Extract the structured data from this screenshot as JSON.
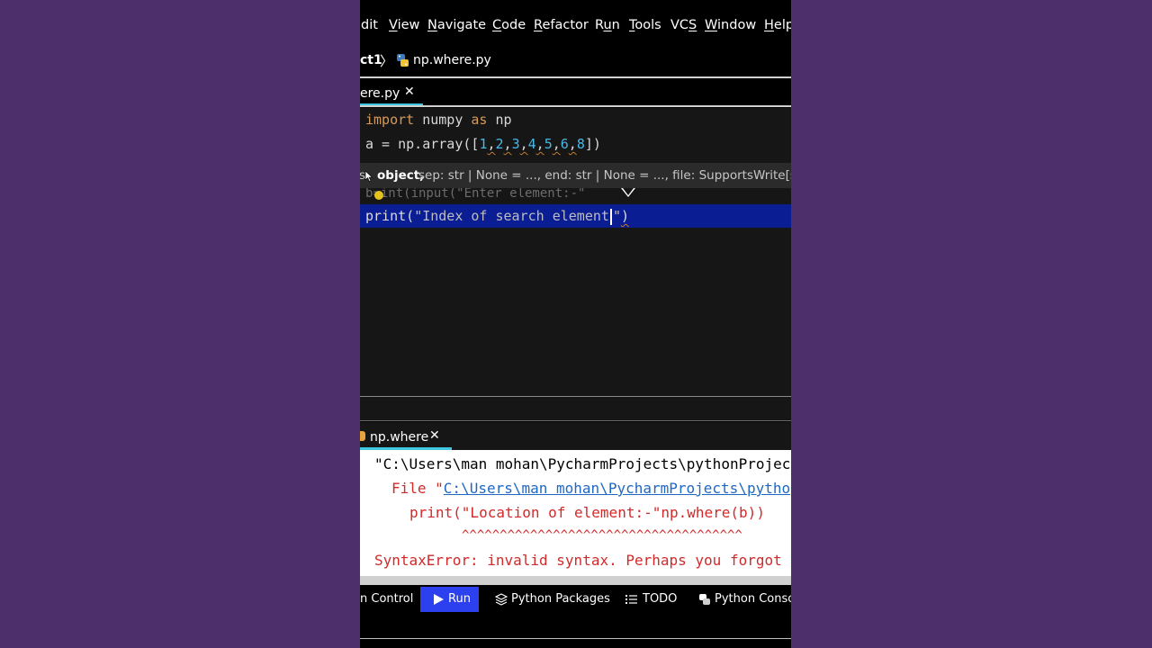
{
  "menu": {
    "items": [
      {
        "pre": "",
        "ul": "",
        "post": "dit"
      },
      {
        "pre": "",
        "ul": "V",
        "post": "iew"
      },
      {
        "pre": "",
        "ul": "N",
        "post": "avigate"
      },
      {
        "pre": "",
        "ul": "C",
        "post": "ode"
      },
      {
        "pre": "",
        "ul": "R",
        "post": "efactor"
      },
      {
        "pre": "R",
        "ul": "u",
        "post": "n"
      },
      {
        "pre": "",
        "ul": "T",
        "post": "ools"
      },
      {
        "pre": "VC",
        "ul": "S",
        "post": ""
      },
      {
        "pre": "",
        "ul": "W",
        "post": "indow"
      },
      {
        "pre": "",
        "ul": "H",
        "post": "elp"
      }
    ]
  },
  "breadcrumb": {
    "project": "ct1",
    "separator": "〉",
    "file": "np.where.py"
  },
  "editor_tab": {
    "label": "ere.py",
    "close": "✕"
  },
  "editor": {
    "line1": {
      "kw1": "import",
      "t1": " numpy ",
      "kw2": "as",
      "t2": " np"
    },
    "line2": {
      "pre": "a = np.array([",
      "n1": "1",
      "n2": "2",
      "n3": "3",
      "n4": "4",
      "n5": "5",
      "n6": "6",
      "n7": "8",
      "comma": ",",
      "post": "])"
    },
    "hint": {
      "prefix": "s",
      "bold": "object,",
      "rest": " sep: str | None = ..., end: str | None = ..., file: SupportsWrite[str] | N"
    },
    "hidden_line": "b=int(input(\"Enter element:-\"",
    "selected_line": {
      "fn": "print(",
      "str_a": "\"Index of search element",
      "str_b": "\"",
      "post": ")"
    }
  },
  "run_tab": {
    "label": "np.where",
    "close": "✕"
  },
  "console": {
    "line1": "\"C:\\Users\\man mohan\\PycharmProjects\\pythonProjec",
    "line2_prefix": "File \"",
    "line2_link": "C:\\Users\\man mohan\\PycharmProjects\\pytho",
    "line3": "print(\"Location of element:-\"np.where(b))",
    "line4": "^^^^^^^^^^^^^^^^^^^^^^^^^^^^^^^^^^^^^",
    "line5": "SyntaxError: invalid syntax. Perhaps you forgot"
  },
  "toolwindows": {
    "version_control": "n Control",
    "run": "Run",
    "python_packages": "Python Packages",
    "todo": "TODO",
    "python_console": "Python Console"
  },
  "colors": {
    "background": "#4d2f6b",
    "accent_tab": "#3fc8e0",
    "selection": "#0b1d93",
    "run_active": "#2c40f0",
    "keyword": "#d59a5c",
    "number": "#46b8e8",
    "error_red": "#d12a2a"
  }
}
